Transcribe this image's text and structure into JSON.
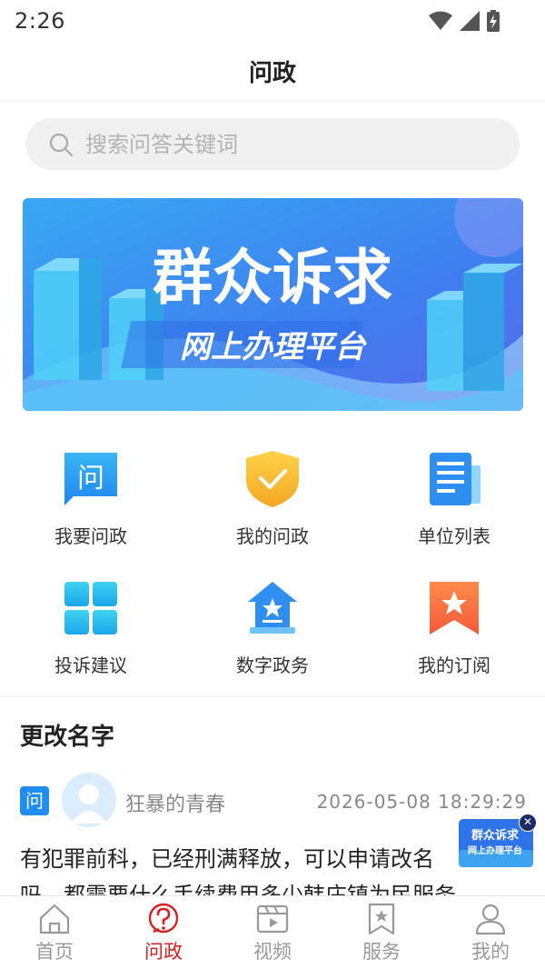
{
  "status_bar": {
    "time": "2:26"
  },
  "nav": {
    "title": "问政"
  },
  "search": {
    "placeholder": "搜索问答关键词"
  },
  "banner": {
    "title": "群众诉求",
    "subtitle": "网上办理平台"
  },
  "grid": [
    {
      "label": "我要问政",
      "icon": "ask-icon"
    },
    {
      "label": "我的问政",
      "icon": "shield-check-icon"
    },
    {
      "label": "单位列表",
      "icon": "document-list-icon"
    },
    {
      "label": "投诉建议",
      "icon": "grid-tiles-icon"
    },
    {
      "label": "数字政务",
      "icon": "government-building-icon"
    },
    {
      "label": "我的订阅",
      "icon": "bookmark-star-icon"
    }
  ],
  "section": {
    "title": "更改名字"
  },
  "post": {
    "badge": "问",
    "user": "狂暴的青春",
    "time": "2026-05-08 18:29:29",
    "line1": "有犯罪前科，已经刑满释放，可以申请改名",
    "line2": "吗，都需要什么手续费用多少韩庄镇为民服务"
  },
  "float_ad": {
    "line1": "群众诉求",
    "line2": "网上办理平台",
    "close": "✕"
  },
  "tabs": [
    {
      "label": "首页",
      "icon": "home-icon"
    },
    {
      "label": "问政",
      "icon": "question-circle-icon"
    },
    {
      "label": "视频",
      "icon": "video-icon"
    },
    {
      "label": "服务",
      "icon": "service-bookmark-icon"
    },
    {
      "label": "我的",
      "icon": "user-icon"
    }
  ],
  "colors": {
    "accent": "#d32020",
    "primary_blue": "#1f8ef0",
    "muted": "#999999"
  }
}
